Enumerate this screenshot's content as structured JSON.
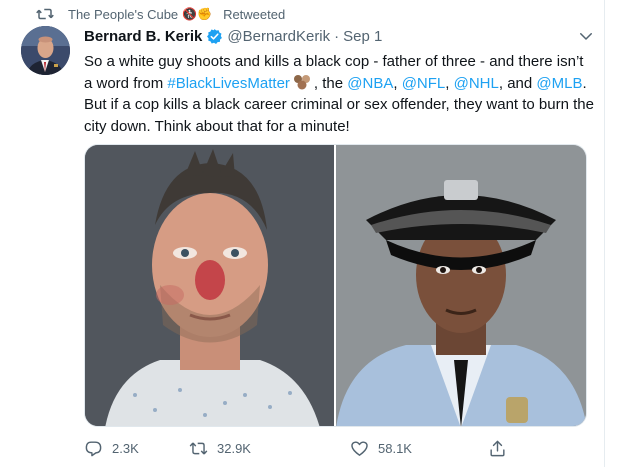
{
  "retweet_bar": {
    "retweeter": "The People's Cube",
    "emoji": "🚷✊",
    "label": "Retweeted"
  },
  "tweet": {
    "author_name": "Bernard B. Kerik",
    "author_handle": "@BernardKerik",
    "separator": "·",
    "date": "Sep 1",
    "text": {
      "part1": "So a white guy shoots and kills a black cop - father of three - and there isn’t a word from ",
      "hashtag": "#BlackLivesMatter",
      "part2": ", the ",
      "mention1": "@NBA",
      "sep1": ", ",
      "mention2": "@NFL",
      "sep2": ", ",
      "mention3": "@NHL",
      "sep3": ", and ",
      "mention4": "@MLB",
      "part3": ". But if a cop kills a black career criminal or sex offender, they want to burn the city down. Think about that for a minute!"
    }
  },
  "actions": {
    "replies": "2.3K",
    "retweets": "32.9K",
    "likes": "58.1K"
  },
  "colors": {
    "link": "#1da1f2",
    "secondary_text": "#536471",
    "verified_badge": "#1da1f2"
  }
}
